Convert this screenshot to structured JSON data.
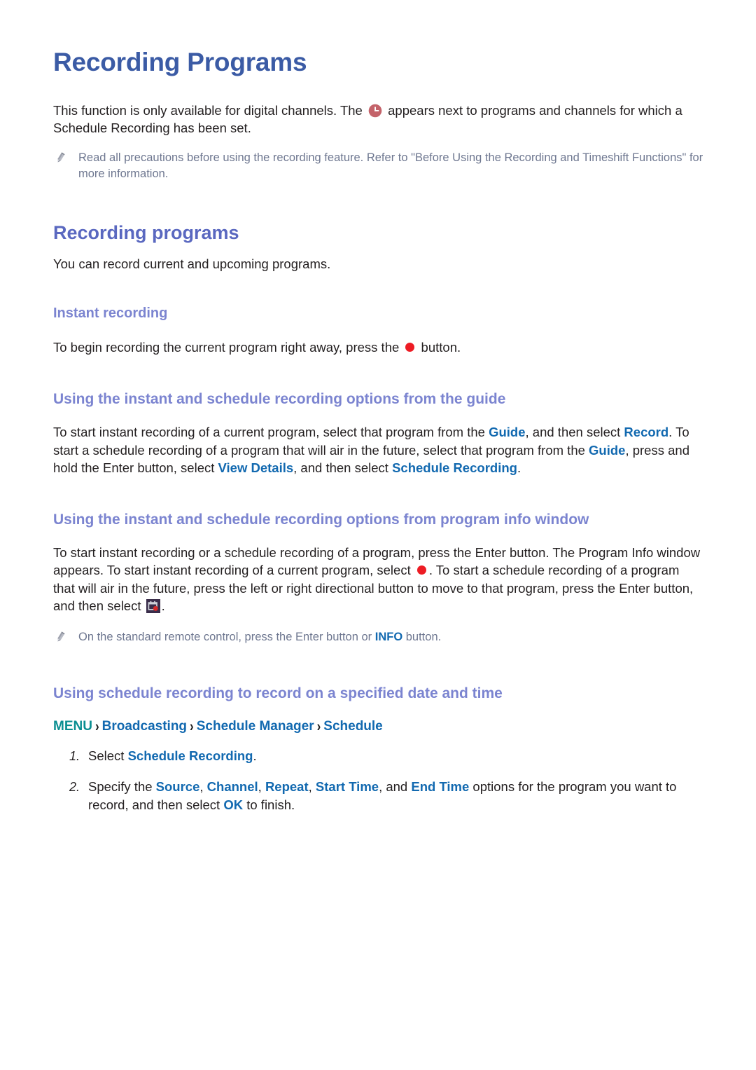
{
  "document": {
    "title": "Recording Programs"
  },
  "intro": {
    "text_before_icon": "This function is only available for digital channels. The ",
    "icon": "clock-icon",
    "text_after_icon": " appears next to programs and channels for which a Schedule Recording has been set."
  },
  "notes": [
    {
      "icon": "pencil-icon",
      "text": "Read all precautions before using the recording feature. Refer to \"Before Using the Recording and Timeshift Functions\" for more information."
    },
    {
      "icon": "pencil-icon",
      "text_before": "On the standard remote control, press the Enter button or ",
      "term": "INFO",
      "text_after": " button."
    }
  ],
  "section_recording_programs": {
    "heading": "Recording programs",
    "intro": "You can record current and upcoming programs."
  },
  "subsection_instant_recording": {
    "heading": "Instant recording",
    "text_before_icon": "To begin recording the current program right away, press the ",
    "icon": "record-dot-icon",
    "text_after_icon": " button."
  },
  "subsection_from_guide": {
    "heading": "Using the instant and schedule recording options from the guide",
    "p1_a": "To start instant recording of a current program, select that program from the ",
    "p1_term1": "Guide",
    "p1_b": ", and then select ",
    "p1_term2": "Record",
    "p1_c": ". To start a schedule recording of a program that will air in the future, select that program from the ",
    "p1_term3": "Guide",
    "p1_d": ", press and hold the Enter button, select ",
    "p1_term4": "View Details",
    "p1_e": ", and then select ",
    "p1_term5": "Schedule Recording",
    "p1_f": "."
  },
  "subsection_program_info": {
    "heading": "Using the instant and schedule recording options from program info window",
    "p1_a": "To start instant recording or a schedule recording of a program, press the Enter button. The Program Info window appears. To start instant recording of a current program, select ",
    "p1_icon1": "record-dot-icon",
    "p1_b": ". To start a schedule recording of a program that will air in the future, press the left or right directional button to move to that program, press the Enter button, and then select ",
    "p1_icon2": "schedule-recording-icon",
    "p1_c": "."
  },
  "subsection_specified_date": {
    "heading": "Using schedule recording to record on a specified date and time",
    "menu_path": {
      "root": "MENU",
      "separator": "›",
      "crumbs": [
        "Broadcasting",
        "Schedule Manager",
        "Schedule"
      ]
    },
    "steps": [
      {
        "number": "1.",
        "a": "Select ",
        "term1": "Schedule Recording",
        "b": "."
      },
      {
        "number": "2.",
        "a": "Specify the ",
        "term1": "Source",
        "b": ", ",
        "term2": "Channel",
        "c": ", ",
        "term3": "Repeat",
        "d": ", ",
        "term4": "Start Time",
        "e": ", and ",
        "term5": "End Time",
        "f": " options for the program you want to record, and then select ",
        "term6": "OK",
        "g": " to finish."
      }
    ]
  },
  "colors": {
    "title_blue": "#3b5ba5",
    "h2_blue": "#5a68c0",
    "h3_periwinkle": "#7b84d0",
    "term_blue": "#1269b0",
    "menu_teal": "#0a8e91",
    "note_gray": "#6e7790",
    "record_red": "#ed1c24",
    "clock_rose": "#c4636a",
    "schedule_icon_bg": "#3a2d4a"
  }
}
